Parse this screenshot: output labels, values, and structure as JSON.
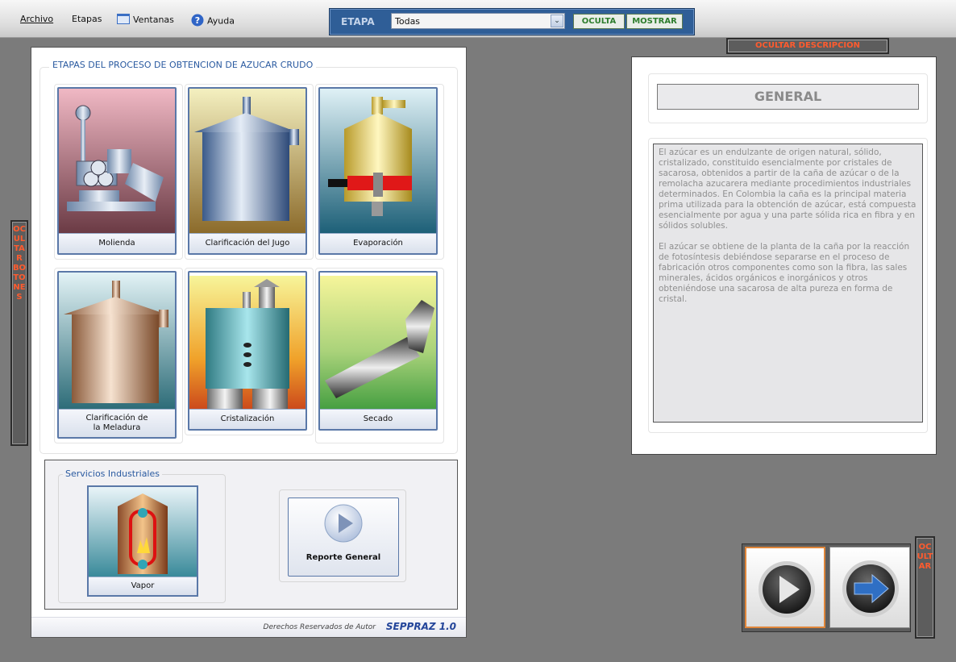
{
  "menu": {
    "archivo": "Archivo",
    "etapas": "Etapas",
    "ventanas": "Ventanas",
    "ayuda": "Ayuda"
  },
  "etapa_bar": {
    "label": "ETAPA",
    "selected": "Todas",
    "oculta": "OCULTA",
    "mostrar": "MOSTRAR"
  },
  "stages": {
    "title": "ETAPAS DEL PROCESO DE OBTENCION DE AZUCAR CRUDO",
    "items": [
      {
        "label": "Molienda"
      },
      {
        "label": "Clarificación del Jugo"
      },
      {
        "label": "Evaporación"
      },
      {
        "label": "Clarificación de\nla Meladura"
      },
      {
        "label": "Cristalización"
      },
      {
        "label": "Secado"
      }
    ]
  },
  "services": {
    "title": "Servicios Industriales",
    "vapor": "Vapor",
    "report": "Reporte General"
  },
  "footer": {
    "copyright": "Derechos Reservados de Autor",
    "version": "SEPPRAZ 1.0"
  },
  "description": {
    "hide_label": "OCULTAR DESCRIPCION",
    "title": "GENERAL",
    "paragraphs": [
      "El azúcar es un endulzante de origen natural, sólido, cristalizado, constituido esencialmente por cristales de sacarosa, obtenidos a partir de la caña de azúcar o de la remolacha azucarera mediante procedimientos industriales determinados. En Colombia la caña es la principal materia prima utilizada para la obtención de azúcar, está compuesta esencialmente por agua y una parte sólida rica en fibra y en sólidos solubles.",
      "El azúcar se obtiene de la planta de la caña por la reacción de fotosíntesis debiéndose separarse en el proceso de fabricación otros componentes como son la fibra, las sales minerales, ácidos orgánicos e inorgánicos y otros obteniéndose una sacarosa de alta pureza en forma de cristal."
    ]
  },
  "toggles": {
    "hide_buttons": "OCULTAR BOTONES",
    "hide_nav": "OCULTAR"
  }
}
